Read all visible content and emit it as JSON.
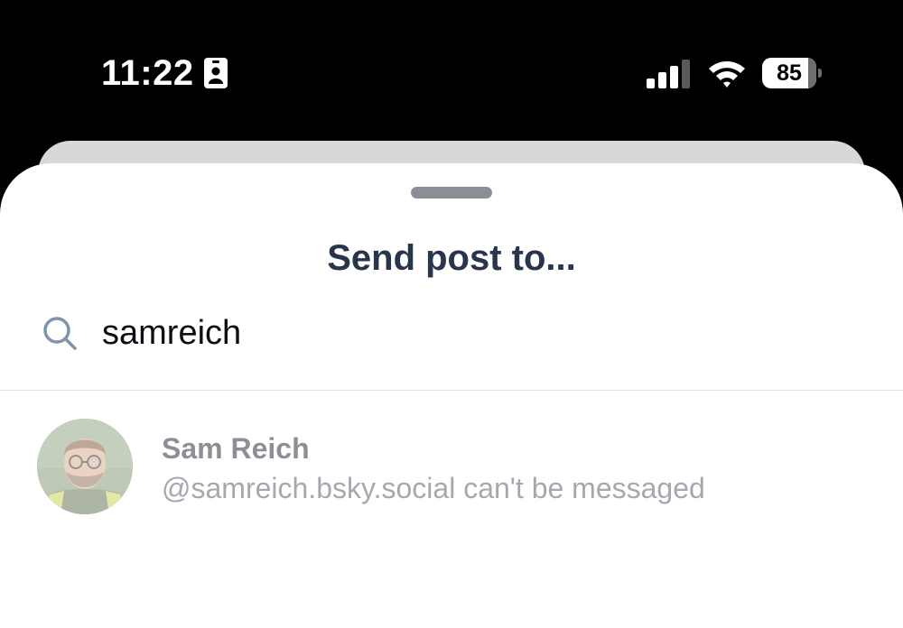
{
  "status_bar": {
    "time": "11:22",
    "battery_level": "85",
    "battery_percent": 85,
    "icons": [
      "id-card-icon",
      "cellular-signal-icon",
      "wifi-icon",
      "battery-icon"
    ]
  },
  "sheet": {
    "title": "Send post to...",
    "search": {
      "value": "samreich",
      "icon": "search-icon"
    },
    "results": [
      {
        "name": "Sam Reich",
        "subtitle": "@samreich.bsky.social can't be messaged",
        "disabled": true
      }
    ]
  },
  "colors": {
    "title": "#27364a",
    "search_icon": "#7f93ab",
    "divider": "#dde1e6",
    "handle": "#8a8f96"
  }
}
